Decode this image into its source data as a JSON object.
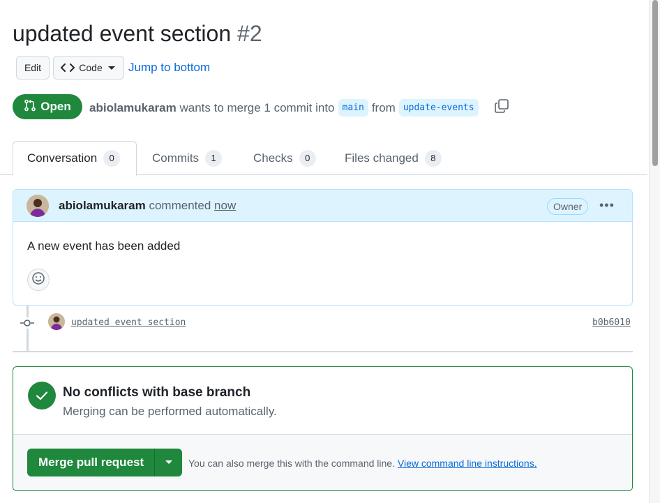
{
  "pr": {
    "title": "updated event section",
    "number": "#2",
    "status": "Open",
    "author": "abiolamukaram",
    "merge_text": "wants to merge 1 commit into",
    "base_branch": "main",
    "from_text": "from",
    "head_branch": "update-events"
  },
  "header_actions": {
    "edit_label": "Edit",
    "code_label": "Code",
    "jump_label": "Jump to bottom"
  },
  "tabs": [
    {
      "label": "Conversation",
      "count": "0"
    },
    {
      "label": "Commits",
      "count": "1"
    },
    {
      "label": "Checks",
      "count": "0"
    },
    {
      "label": "Files changed",
      "count": "8"
    }
  ],
  "comment": {
    "author": "abiolamukaram",
    "verb": "commented",
    "time": "now",
    "role": "Owner",
    "body": "A new event has been added"
  },
  "commit": {
    "message": "updated event section",
    "sha": "b0b6010"
  },
  "merge": {
    "title": "No conflicts with base branch",
    "subtitle": "Merging can be performed automatically.",
    "button_label": "Merge pull request",
    "note": "You can also merge this with the command line.",
    "note_link": "View command line instructions."
  },
  "colors": {
    "accent_green": "#1f883d",
    "link_blue": "#0969da",
    "comment_header_bg": "#ddf4ff"
  }
}
